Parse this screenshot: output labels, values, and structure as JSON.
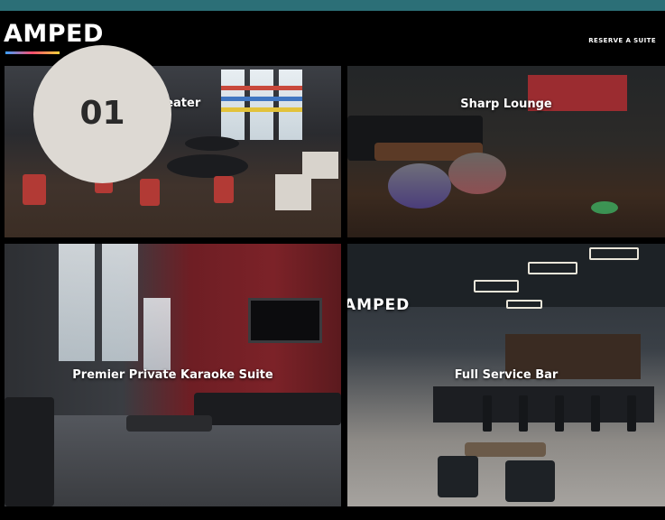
{
  "header": {
    "logo_text": "AMPED",
    "reserve_label": "RESERVE A SUITE"
  },
  "tiles": [
    {
      "label": "theater"
    },
    {
      "label": "Sharp Lounge"
    },
    {
      "label": "Premier Private Karaoke Suite"
    },
    {
      "label": "Full Service Bar"
    }
  ],
  "badge": {
    "number": "01"
  },
  "bar_sign": "AMPED"
}
